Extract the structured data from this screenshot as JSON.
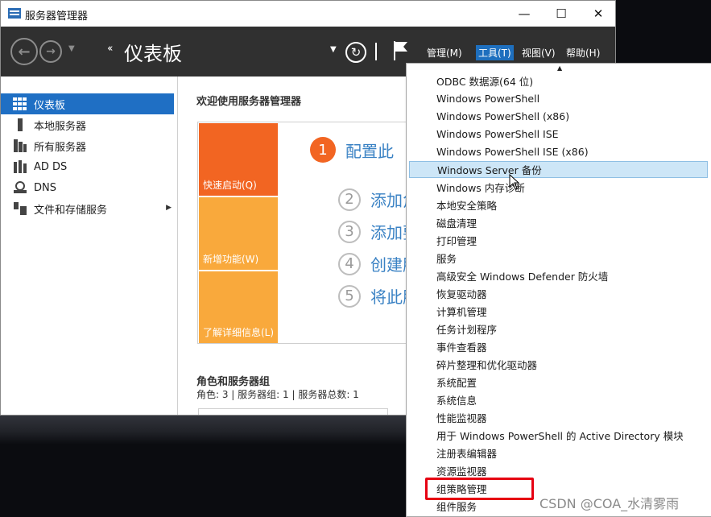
{
  "window": {
    "title": "服务器管理器",
    "minimize_glyph": "—",
    "maximize_glyph": "☐",
    "close_glyph": "✕"
  },
  "header": {
    "crumb_arrows": "‹‹",
    "title": "仪表板",
    "menus": [
      {
        "label": "管理(M)",
        "active": false
      },
      {
        "label": "工具(T)",
        "active": true
      },
      {
        "label": "视图(V)",
        "active": false
      },
      {
        "label": "帮助(H)",
        "active": false
      }
    ]
  },
  "sidebar": {
    "items": [
      {
        "label": "仪表板",
        "icon": "dashboard-icon",
        "active": true
      },
      {
        "label": "本地服务器",
        "icon": "local-server-icon",
        "active": false
      },
      {
        "label": "所有服务器",
        "icon": "all-servers-icon",
        "active": false
      },
      {
        "label": "AD DS",
        "icon": "ad-ds-icon",
        "active": false
      },
      {
        "label": "DNS",
        "icon": "dns-icon",
        "active": false
      },
      {
        "label": "文件和存储服务",
        "icon": "file-storage-icon",
        "active": false,
        "has_arrow": true
      }
    ]
  },
  "main": {
    "welcome": "欢迎使用服务器管理器",
    "tiles": [
      "快速启动(Q)",
      "新增功能(W)",
      "了解详细信息(L)"
    ],
    "steps": [
      {
        "num": "1",
        "text": "配置此"
      },
      {
        "num": "2",
        "text": "添加角"
      },
      {
        "num": "3",
        "text": "添加要"
      },
      {
        "num": "4",
        "text": "创建服"
      },
      {
        "num": "5",
        "text": "将此服"
      }
    ],
    "roles_title": "角色和服务器组",
    "roles_summary": "角色: 3 | 服务器组: 1 | 服务器总数: 1"
  },
  "tools_menu": {
    "highlighted_index": 5,
    "items": [
      "ODBC 数据源(64 位)",
      "Windows PowerShell",
      "Windows PowerShell (x86)",
      "Windows PowerShell ISE",
      "Windows PowerShell ISE (x86)",
      "Windows Server 备份",
      "Windows 内存诊断",
      "本地安全策略",
      "磁盘清理",
      "打印管理",
      "服务",
      "高级安全 Windows Defender 防火墙",
      "恢复驱动器",
      "计算机管理",
      "任务计划程序",
      "事件查看器",
      "碎片整理和优化驱动器",
      "系统配置",
      "系统信息",
      "性能监视器",
      "用于 Windows PowerShell 的 Active Directory 模块",
      "注册表编辑器",
      "资源监视器",
      "组策略管理",
      "组件服务"
    ]
  },
  "watermark": "CSDN @COA_水清雾雨",
  "colors": {
    "header_bg": "#303030",
    "accent_blue": "#1f6fc4",
    "tile_orange_dark": "#f26522",
    "tile_orange_light": "#f9a93c",
    "annotation_red": "#e60012"
  }
}
